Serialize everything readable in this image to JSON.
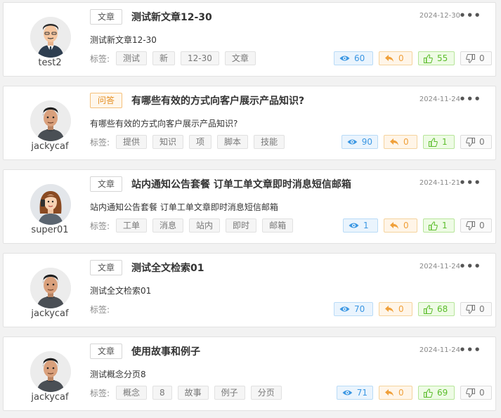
{
  "labels": {
    "tags": "标签:",
    "more": "•••"
  },
  "posts": [
    {
      "user": "test2",
      "avatar": "man-suit-avatar",
      "type": "文章",
      "type_style": "article",
      "title": "测试新文章12-30",
      "date": "2024-12-30",
      "summary": "测试新文章12-30",
      "tags": [
        "测试",
        "新",
        "12-30",
        "文章"
      ],
      "views": "60",
      "replies": "0",
      "likes": "55",
      "dislikes": "0"
    },
    {
      "user": "jackycaf",
      "avatar": "man-tshirt-avatar",
      "type": "问答",
      "type_style": "qa",
      "title": "有哪些有效的方式向客户展示产品知识?",
      "date": "2024-11-24",
      "summary": "有哪些有效的方式向客户展示产品知识?",
      "tags": [
        "提供",
        "知识",
        "项",
        "脚本",
        "技能"
      ],
      "views": "90",
      "replies": "0",
      "likes": "1",
      "dislikes": "0"
    },
    {
      "user": "super01",
      "avatar": "woman-avatar",
      "type": "文章",
      "type_style": "article",
      "title": "站内通知公告套餐 订单工单文章即时消息短信邮箱",
      "date": "2024-11-21",
      "summary": "站内通知公告套餐 订单工单文章即时消息短信邮箱",
      "tags": [
        "工单",
        "消息",
        "站内",
        "即时",
        "邮箱"
      ],
      "views": "1",
      "replies": "0",
      "likes": "1",
      "dislikes": "0"
    },
    {
      "user": "jackycaf",
      "avatar": "man-tshirt-avatar",
      "type": "文章",
      "type_style": "article",
      "title": "测试全文检索01",
      "date": "2024-11-24",
      "summary": "测试全文检索01",
      "tags": [],
      "views": "70",
      "replies": "0",
      "likes": "68",
      "dislikes": "0"
    },
    {
      "user": "jackycaf",
      "avatar": "man-tshirt-avatar",
      "type": "文章",
      "type_style": "article",
      "title": "使用故事和例子",
      "date": "2024-11-24",
      "summary": "测试概念分页8",
      "tags": [
        "概念",
        "8",
        "故事",
        "例子",
        "分页"
      ],
      "views": "71",
      "replies": "0",
      "likes": "69",
      "dislikes": "0"
    }
  ]
}
